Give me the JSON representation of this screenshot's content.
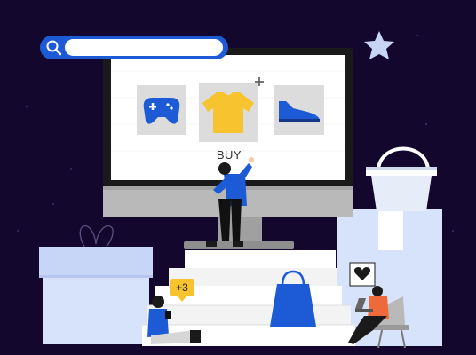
{
  "search": {
    "value": "",
    "placeholder": ""
  },
  "screen": {
    "buy_label": "BUY"
  },
  "notification": {
    "count_label": "+3"
  },
  "products": [
    {
      "name": "gamepad"
    },
    {
      "name": "t-shirt"
    },
    {
      "name": "sneaker"
    }
  ],
  "colors": {
    "background": "#14072e",
    "accent_blue": "#1d5bd6",
    "shirt_yellow": "#f7c430",
    "monitor_gray": "#b9b9b9",
    "light_blue": "#d7e3fb",
    "sweater_orange": "#ee6a3b"
  }
}
